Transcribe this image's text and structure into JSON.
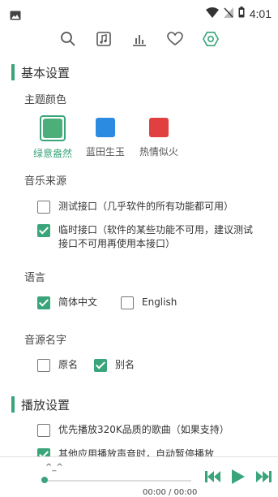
{
  "statusbar": {
    "time": "4:01"
  },
  "toolbar": {
    "icons": [
      "search-icon",
      "music-file-icon",
      "chart-icon",
      "heart-icon",
      "settings-icon"
    ]
  },
  "colors": {
    "accent": "#3aa57a",
    "green": "#4caf7a",
    "blue": "#2b8be0",
    "red": "#e04040"
  },
  "basic_settings": {
    "title": "基本设置",
    "theme_color": {
      "label": "主题颜色",
      "options": [
        {
          "label": "绿意盎然",
          "color": "#4caf7a",
          "selected": true
        },
        {
          "label": "蓝田生玉",
          "color": "#2b8be0",
          "selected": false
        },
        {
          "label": "热情似火",
          "color": "#e04040",
          "selected": false
        }
      ]
    },
    "music_source": {
      "label": "音乐来源",
      "options": [
        {
          "label": "测试接口（几乎软件的所有功能都可用）",
          "checked": false
        },
        {
          "label": "临时接口（软件的某些功能不可用，建议测试接口不可用再使用本接口）",
          "checked": true
        }
      ]
    },
    "language": {
      "label": "语言",
      "options": [
        {
          "label": "简体中文",
          "checked": true
        },
        {
          "label": "English",
          "checked": false
        }
      ]
    },
    "source_name": {
      "label": "音源名字",
      "options": [
        {
          "label": "原名",
          "checked": false
        },
        {
          "label": "别名",
          "checked": true
        }
      ]
    }
  },
  "play_settings": {
    "title": "播放设置",
    "options": [
      {
        "label": "优先播放320K品质的歌曲（如果支持）",
        "checked": false
      },
      {
        "label": "其他应用播放声音时，自动暂停播放",
        "checked": true
      }
    ]
  },
  "player": {
    "title": "^_^",
    "time": "00:00 / 00:00"
  }
}
